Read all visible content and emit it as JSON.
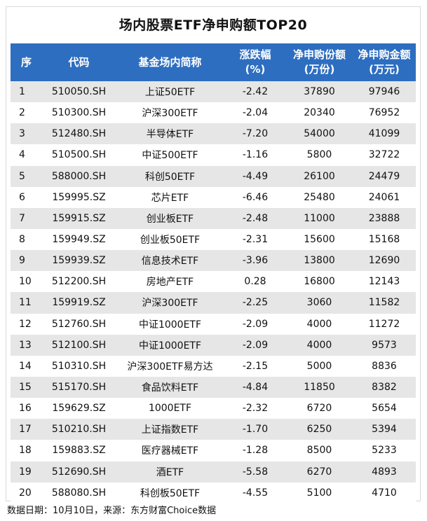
{
  "title": "场内股票ETF净申购额TOP20",
  "headers": {
    "rank": "序",
    "code": "代码",
    "name": "基金场内简称",
    "change_l1": "涨跌幅",
    "change_l2": "(%)",
    "shares_l1": "净申购份额",
    "shares_l2": "(万份)",
    "amount_l1": "净申购金额",
    "amount_l2": "(万元)"
  },
  "rows": [
    {
      "rank": "1",
      "code": "510050.SH",
      "name": "上证50ETF",
      "change": "-2.42",
      "shares": "37890",
      "amount": "97946"
    },
    {
      "rank": "2",
      "code": "510300.SH",
      "name": "沪深300ETF",
      "change": "-2.04",
      "shares": "20340",
      "amount": "76952"
    },
    {
      "rank": "3",
      "code": "512480.SH",
      "name": "半导体ETF",
      "change": "-7.20",
      "shares": "54000",
      "amount": "41099"
    },
    {
      "rank": "4",
      "code": "510500.SH",
      "name": "中证500ETF",
      "change": "-1.16",
      "shares": "5800",
      "amount": "32722"
    },
    {
      "rank": "5",
      "code": "588000.SH",
      "name": "科创50ETF",
      "change": "-4.49",
      "shares": "26100",
      "amount": "24479"
    },
    {
      "rank": "6",
      "code": "159995.SZ",
      "name": "芯片ETF",
      "change": "-6.46",
      "shares": "25480",
      "amount": "24061"
    },
    {
      "rank": "7",
      "code": "159915.SZ",
      "name": "创业板ETF",
      "change": "-2.48",
      "shares": "11000",
      "amount": "23888"
    },
    {
      "rank": "8",
      "code": "159949.SZ",
      "name": "创业板50ETF",
      "change": "-2.31",
      "shares": "15600",
      "amount": "15168"
    },
    {
      "rank": "9",
      "code": "159939.SZ",
      "name": "信息技术ETF",
      "change": "-3.96",
      "shares": "13800",
      "amount": "12690"
    },
    {
      "rank": "10",
      "code": "512200.SH",
      "name": "房地产ETF",
      "change": "0.28",
      "shares": "16800",
      "amount": "12143"
    },
    {
      "rank": "11",
      "code": "159919.SZ",
      "name": "沪深300ETF",
      "change": "-2.25",
      "shares": "3060",
      "amount": "11582"
    },
    {
      "rank": "12",
      "code": "512760.SH",
      "name": "中证1000ETF",
      "change": "-2.09",
      "shares": "4000",
      "amount": "11272"
    },
    {
      "rank": "13",
      "code": "512100.SH",
      "name": "中证1000ETF",
      "change": "-2.09",
      "shares": "4000",
      "amount": "9573"
    },
    {
      "rank": "14",
      "code": "510310.SH",
      "name": "沪深300ETF易方达",
      "change": "-2.15",
      "shares": "5000",
      "amount": "8836"
    },
    {
      "rank": "15",
      "code": "515170.SH",
      "name": "食品饮料ETF",
      "change": "-4.84",
      "shares": "11850",
      "amount": "8382"
    },
    {
      "rank": "16",
      "code": "159629.SZ",
      "name": "1000ETF",
      "change": "-2.32",
      "shares": "6720",
      "amount": "5654"
    },
    {
      "rank": "17",
      "code": "510210.SH",
      "name": "上证指数ETF",
      "change": "-1.70",
      "shares": "6250",
      "amount": "5394"
    },
    {
      "rank": "18",
      "code": "159883.SZ",
      "name": "医疗器械ETF",
      "change": "-1.28",
      "shares": "8500",
      "amount": "5233"
    },
    {
      "rank": "19",
      "code": "512690.SH",
      "name": "酒ETF",
      "change": "-5.58",
      "shares": "6270",
      "amount": "4893"
    },
    {
      "rank": "20",
      "code": "588080.SH",
      "name": "科创板50ETF",
      "change": "-4.55",
      "shares": "5100",
      "amount": "4710"
    }
  ],
  "footer": "数据日期：10月10日，来源：东方财富Choice数据",
  "colors": {
    "header_bg": "#2d6ec0",
    "header_text": "#ffffff",
    "row_stripe": "#e6e6e6"
  }
}
